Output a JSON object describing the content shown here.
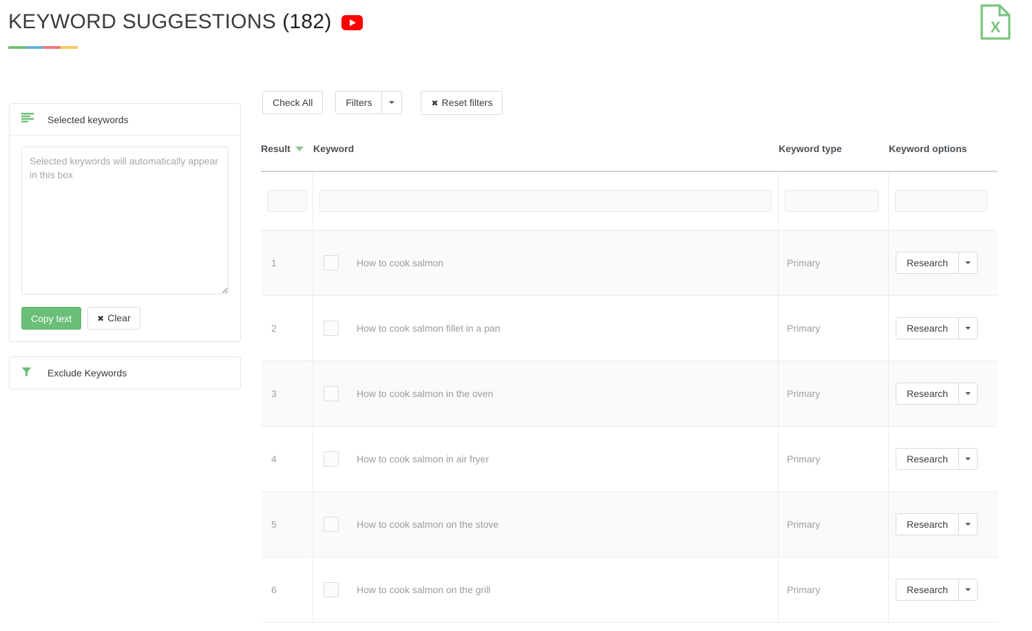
{
  "header": {
    "title": "KEYWORD SUGGESTIONS",
    "count": "(182)",
    "youtube_icon": "youtube-icon",
    "underline_colors": [
      "#74bf72",
      "#6aabdd",
      "#f4757a",
      "#f4ca5f"
    ],
    "export_icon": "excel-export-icon",
    "export_label": "X"
  },
  "sidebar": {
    "selected_panel": {
      "icon": "list-icon",
      "title": "Selected keywords",
      "textarea_placeholder": "Selected keywords will automatically appear in this box",
      "textarea_value": "",
      "copy_label": "Copy text",
      "clear_label": "Clear",
      "clear_icon": "x-icon"
    },
    "exclude_panel": {
      "icon": "filter-icon",
      "title": "Exclude Keywords"
    }
  },
  "toolbar": {
    "check_all_label": "Check All",
    "filters_label": "Filters",
    "filters_caret_icon": "chevron-down-icon",
    "reset_filters_label": "Reset filters",
    "reset_icon": "x-icon"
  },
  "table": {
    "columns": {
      "result": "Result",
      "keyword": "Keyword",
      "type": "Keyword type",
      "options": "Keyword options"
    },
    "sort_icon": "sort-desc-icon",
    "filters": {
      "result": "",
      "keyword": "",
      "type": "",
      "options": ""
    },
    "rows": [
      {
        "num": "1",
        "keyword": "How to cook salmon",
        "type": "Primary",
        "action": "Research",
        "checked": false
      },
      {
        "num": "2",
        "keyword": "How to cook salmon fillet in a pan",
        "type": "Primary",
        "action": "Research",
        "checked": false
      },
      {
        "num": "3",
        "keyword": "How to cook salmon in the oven",
        "type": "Primary",
        "action": "Research",
        "checked": false
      },
      {
        "num": "4",
        "keyword": "How to cook salmon in air fryer",
        "type": "Primary",
        "action": "Research",
        "checked": false
      },
      {
        "num": "5",
        "keyword": "How to cook salmon on the stove",
        "type": "Primary",
        "action": "Research",
        "checked": false
      },
      {
        "num": "6",
        "keyword": "How to cook salmon on the grill",
        "type": "Primary",
        "action": "Research",
        "checked": false
      }
    ]
  },
  "colors": {
    "accent_green": "#6bbf78",
    "youtube_red": "#ff0000",
    "excel_green": "#7ac37e"
  }
}
